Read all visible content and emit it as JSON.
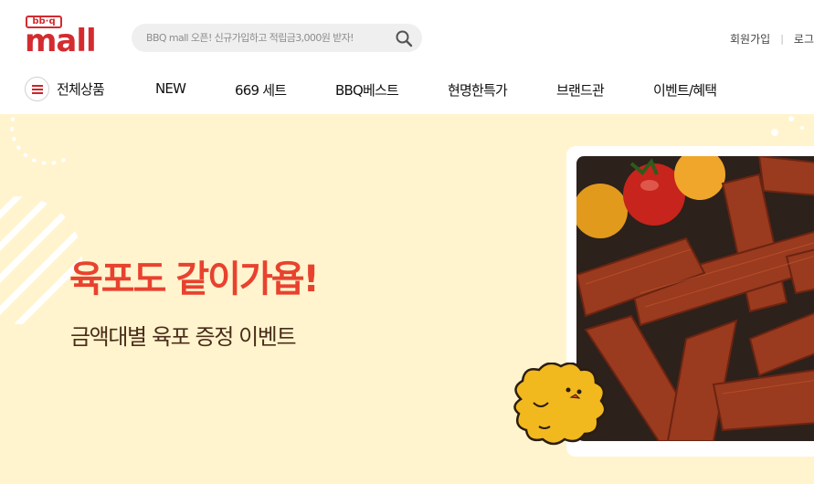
{
  "logo": {
    "top_text": "bb·q",
    "main_text": "mall"
  },
  "search": {
    "placeholder": "BBQ mall 오픈! 신규가입하고 적립금3,000원 받자!"
  },
  "util": {
    "signup": "회원가입",
    "separator": "|",
    "login": "로그"
  },
  "gnb": {
    "all_menu": "전체상품",
    "items": [
      "NEW",
      "669 세트",
      "BBQ베스트",
      "현명한특가",
      "브랜드관",
      "이벤트/혜택"
    ]
  },
  "banner": {
    "headline": "육포도 같이가욥!",
    "subline": "금액대별 육포 증정 이벤트"
  },
  "colors": {
    "brand_red": "#d32b2f",
    "banner_bg": "#fff4cd",
    "headline": "#e8422f",
    "subline": "#4a2c1a",
    "mascot": "#f1b91e"
  },
  "icons": [
    "search-icon",
    "hamburger-menu-icon"
  ]
}
